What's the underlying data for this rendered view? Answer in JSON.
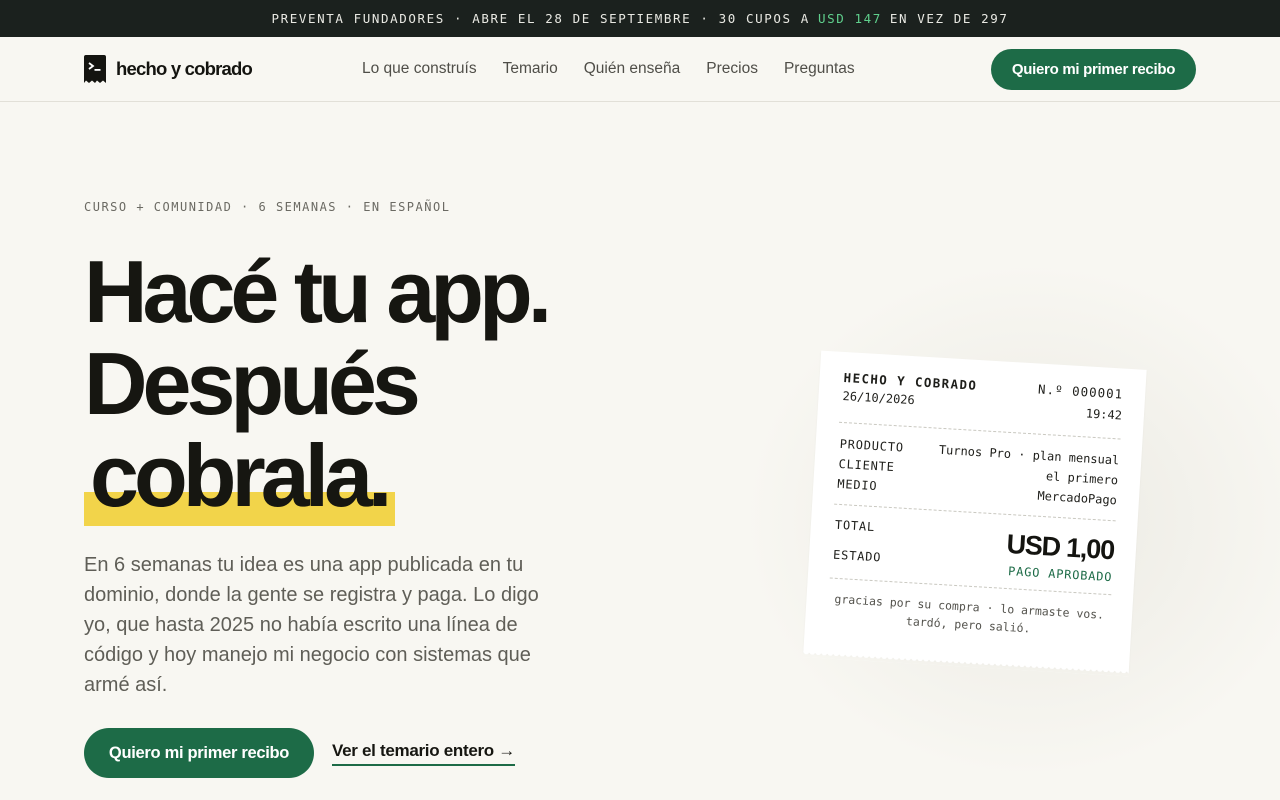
{
  "promo": {
    "text_before": "PREVENTA FUNDADORES · ABRE EL 28 DE SEPTIEMBRE · 30 CUPOS A",
    "price": "USD 147",
    "text_after": "EN VEZ DE 297",
    "price_color": "#5fcf8c"
  },
  "nav": {
    "brand": "hecho y cobrado",
    "logo_icon": "terminal-receipt-icon",
    "links": [
      "Lo que construís",
      "Temario",
      "Quién enseña",
      "Precios",
      "Preguntas"
    ],
    "cta": "Quiero mi primer recibo"
  },
  "hero": {
    "eyebrow": "CURSO + COMUNIDAD · 6 SEMANAS · EN ESPAÑOL",
    "headline": [
      "Hacé tu app.",
      "Después",
      "cobrala."
    ],
    "lead": "En 6 semanas tu idea es una app publicada en tu dominio, donde la gente se registra y paga. Lo digo yo, que hasta 2025 no había escrito una línea de código y hoy manejo mi negocio con sistemas que armé así.",
    "cta": "Quiero mi primer recibo",
    "secondary_link": "Ver el temario entero →"
  },
  "receipt": {
    "brand": "HECHO Y COBRADO",
    "date": "26/10/2026",
    "number": "N.º 000001",
    "time": "19:42",
    "labels": [
      "PRODUCTO",
      "CLIENTE",
      "MEDIO"
    ],
    "values": [
      "Turnos Pro · plan mensual",
      "el primero",
      "MercadoPago"
    ],
    "total_label": "TOTAL",
    "state_label": "ESTADO",
    "amount": "USD 1,00",
    "status": "PAGO APROBADO",
    "footer_line1": "gracias por su compra · lo armaste vos.",
    "footer_line2": "tardó, pero salió."
  },
  "colors": {
    "accent_green": "#1d6b47",
    "highlight_yellow": "#f2d44a",
    "background": "#f8f7f2",
    "promo_bg": "#1b211e"
  }
}
